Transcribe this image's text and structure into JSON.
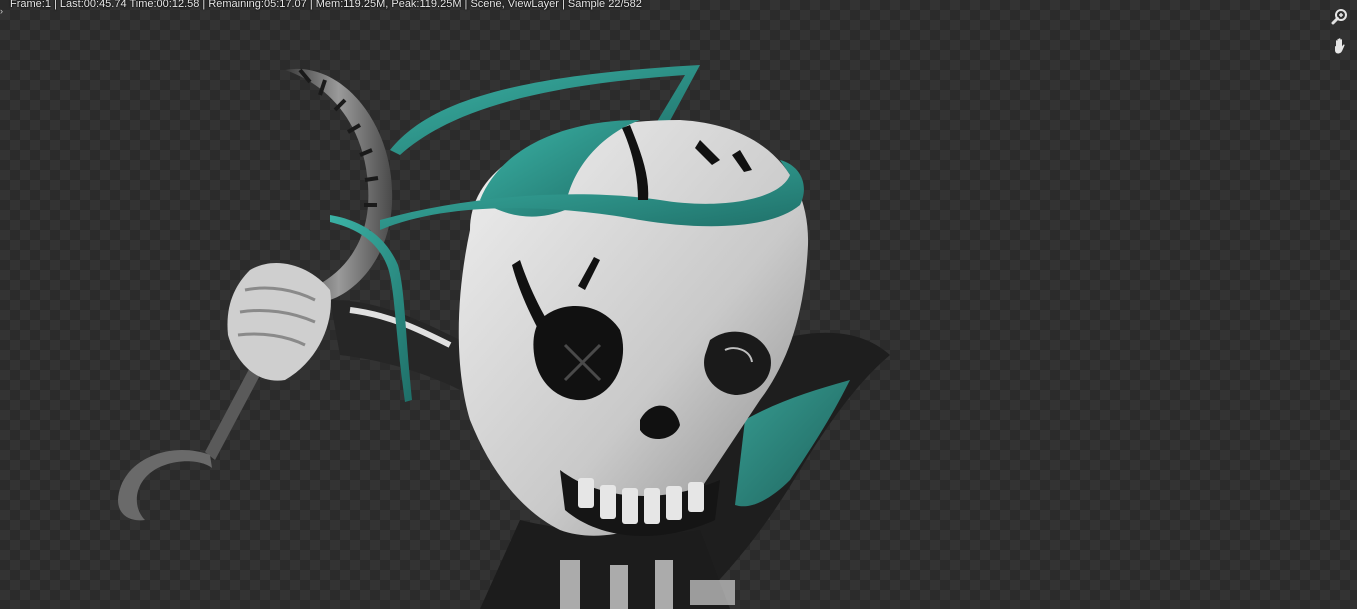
{
  "render_window": {
    "status_text": "Frame:1 | Last:00:45.74 Time:00:12.58 | Remaining:05:17.07 | Mem:119.25M, Peak:119.25M | Scene, ViewLayer | Sample 22/582",
    "collapse_glyph": "›"
  },
  "navigation": {
    "zoom_icon": "zoom-icon",
    "pan_icon": "hand-pan-icon"
  },
  "render": {
    "subject": "stylized skull character with teal hood and scythe",
    "colors": {
      "teal": "#2a8f86",
      "bone": "#d9d9d9",
      "shadow": "#1a1a1a"
    }
  }
}
